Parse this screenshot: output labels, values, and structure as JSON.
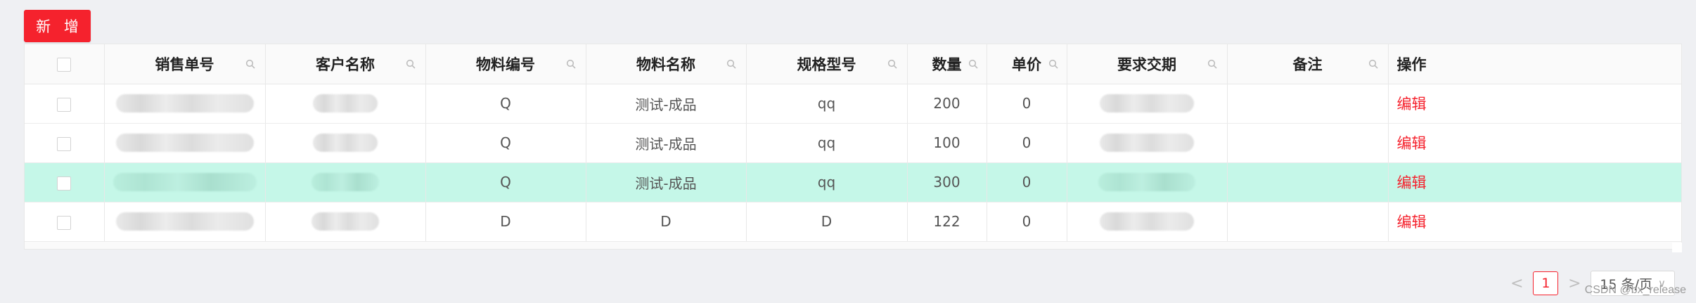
{
  "toolbar": {
    "add_label": "新 增"
  },
  "table": {
    "columns": [
      "销售单号",
      "客户名称",
      "物料编号",
      "物料名称",
      "规格型号",
      "数量",
      "单价",
      "要求交期",
      "备注",
      "操作"
    ],
    "rows": [
      {
        "order_no": "",
        "customer": "",
        "material_code": "Q",
        "material_name": "测试-成品",
        "spec": "qq",
        "qty": "200",
        "price": "0",
        "due_date": "",
        "remark": "",
        "action": "编辑",
        "highlighted": false
      },
      {
        "order_no": "",
        "customer": "",
        "material_code": "Q",
        "material_name": "测试-成品",
        "spec": "qq",
        "qty": "100",
        "price": "0",
        "due_date": "",
        "remark": "",
        "action": "编辑",
        "highlighted": false
      },
      {
        "order_no": "",
        "customer": "",
        "material_code": "Q",
        "material_name": "测试-成品",
        "spec": "qq",
        "qty": "300",
        "price": "0",
        "due_date": "",
        "remark": "",
        "action": "编辑",
        "highlighted": true
      },
      {
        "order_no": "",
        "customer": "",
        "material_code": "D",
        "material_name": "D",
        "spec": "D",
        "qty": "122",
        "price": "0",
        "due_date": "",
        "remark": "",
        "action": "编辑",
        "highlighted": false
      }
    ]
  },
  "pagination": {
    "prev": "<",
    "current_page": "1",
    "next": ">",
    "page_size": "15 条/页",
    "page_size_arrow": "∨"
  },
  "watermark": "CSDN @bx_release",
  "colors": {
    "accent": "#f5222d",
    "row_highlight": "#c5f7e8"
  },
  "icons": {
    "column_search": "search-icon"
  }
}
